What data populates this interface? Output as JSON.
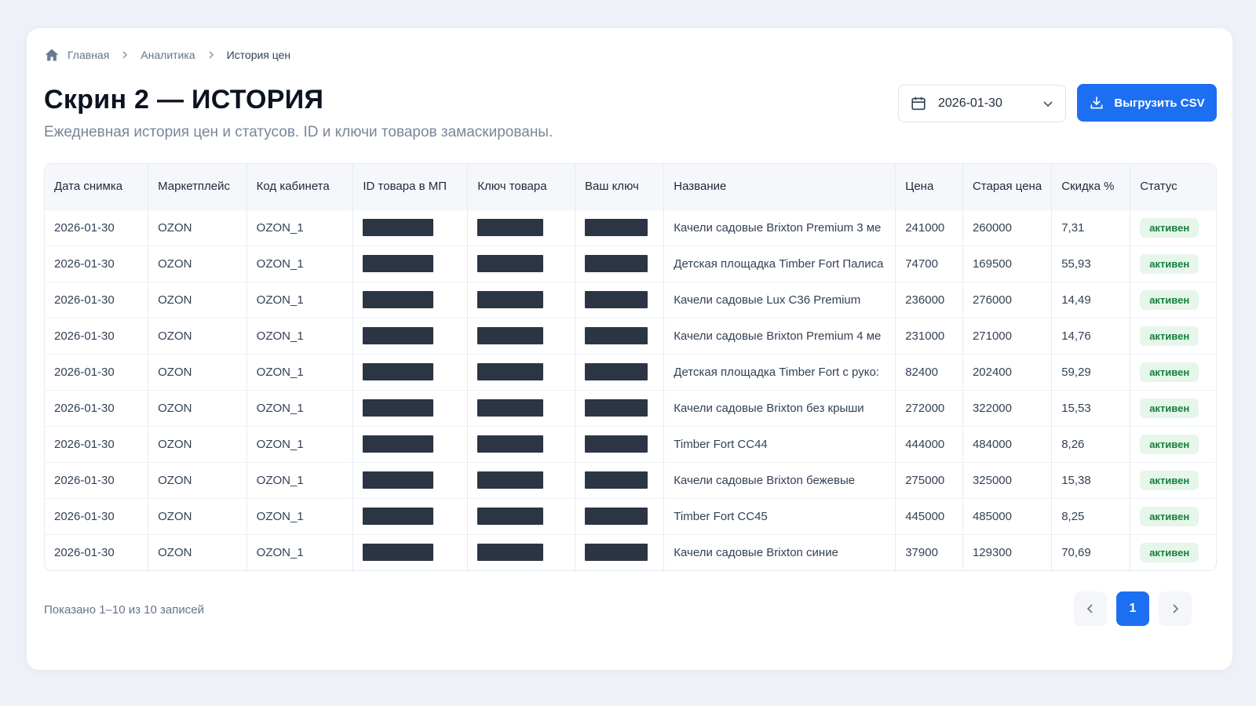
{
  "breadcrumb": {
    "home": "Главная",
    "section": "Аналитика",
    "current": "История цен"
  },
  "header": {
    "title": "Скрин 2 — ИСТОРИЯ",
    "subtitle": "Ежедневная история цен и статусов. ID и ключи товаров замаскированы."
  },
  "toolbar": {
    "date_value": "2026-01-30",
    "export_label": "Выгрузить CSV"
  },
  "colors": {
    "accent": "#1d6ff2",
    "status_active_bg": "#e6f6ea",
    "status_active_text": "#15803d",
    "mask": "#2b3544"
  },
  "icons": {
    "home": "home-icon",
    "separator": "chevron-right-icon",
    "calendar": "calendar-icon",
    "dropdown": "chevron-down-icon",
    "export": "download-icon",
    "prev": "chevron-left-icon",
    "next": "chevron-right-icon"
  },
  "table": {
    "columns": [
      "Дата снимка",
      "Маркетплейс",
      "Код кабинета",
      "ID товара в МП",
      "Ключ товара",
      "Ваш ключ",
      "Название",
      "Цена",
      "Старая цена",
      "Скидка %",
      "Статус"
    ],
    "rows": [
      {
        "date": "2026-01-30",
        "marketplace": "OZON",
        "cabinet": "OZON_1",
        "name": "Качели садовые Brixton Premium 3 ме",
        "price": "241000",
        "old_price": "260000",
        "discount": "7,31",
        "status": "активен"
      },
      {
        "date": "2026-01-30",
        "marketplace": "OZON",
        "cabinet": "OZON_1",
        "name": "Детская площадка Timber Fort Палиса",
        "price": "74700",
        "old_price": "169500",
        "discount": "55,93",
        "status": "активен"
      },
      {
        "date": "2026-01-30",
        "marketplace": "OZON",
        "cabinet": "OZON_1",
        "name": "Качели садовые Lux C36 Premium",
        "price": "236000",
        "old_price": "276000",
        "discount": "14,49",
        "status": "активен"
      },
      {
        "date": "2026-01-30",
        "marketplace": "OZON",
        "cabinet": "OZON_1",
        "name": "Качели садовые Brixton Premium 4 ме",
        "price": "231000",
        "old_price": "271000",
        "discount": "14,76",
        "status": "активен"
      },
      {
        "date": "2026-01-30",
        "marketplace": "OZON",
        "cabinet": "OZON_1",
        "name": "Детская площадка Timber Fort с руко:",
        "price": "82400",
        "old_price": "202400",
        "discount": "59,29",
        "status": "активен"
      },
      {
        "date": "2026-01-30",
        "marketplace": "OZON",
        "cabinet": "OZON_1",
        "name": "Качели садовые Brixton без крыши",
        "price": "272000",
        "old_price": "322000",
        "discount": "15,53",
        "status": "активен"
      },
      {
        "date": "2026-01-30",
        "marketplace": "OZON",
        "cabinet": "OZON_1",
        "name": "Timber Fort CC44",
        "price": "444000",
        "old_price": "484000",
        "discount": "8,26",
        "status": "активен"
      },
      {
        "date": "2026-01-30",
        "marketplace": "OZON",
        "cabinet": "OZON_1",
        "name": "Качели садовые Brixton бежевые",
        "price": "275000",
        "old_price": "325000",
        "discount": "15,38",
        "status": "активен"
      },
      {
        "date": "2026-01-30",
        "marketplace": "OZON",
        "cabinet": "OZON_1",
        "name": "Timber Fort CC45",
        "price": "445000",
        "old_price": "485000",
        "discount": "8,25",
        "status": "активен"
      },
      {
        "date": "2026-01-30",
        "marketplace": "OZON",
        "cabinet": "OZON_1",
        "name": "Качели садовые Brixton синие",
        "price": "37900",
        "old_price": "129300",
        "discount": "70,69",
        "status": "активен"
      }
    ]
  },
  "footer": {
    "shown_text": "Показано 1–10 из 10 записей",
    "current_page": "1"
  }
}
